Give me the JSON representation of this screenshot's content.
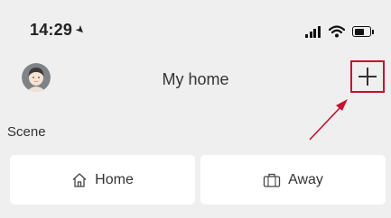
{
  "status_bar": {
    "time": "14:29",
    "location_icon": "location-arrow-icon",
    "signal_icon": "cellular-signal-icon",
    "wifi_icon": "wifi-icon",
    "battery_icon": "battery-icon"
  },
  "header": {
    "title": "My home",
    "avatar_icon": "user-avatar-icon",
    "add_icon": "plus-icon",
    "highlight_color": "#c8102e"
  },
  "scene": {
    "label": "Scene",
    "items": [
      {
        "label": "Home",
        "icon": "house-icon"
      },
      {
        "label": "Away",
        "icon": "suitcase-icon"
      }
    ]
  }
}
